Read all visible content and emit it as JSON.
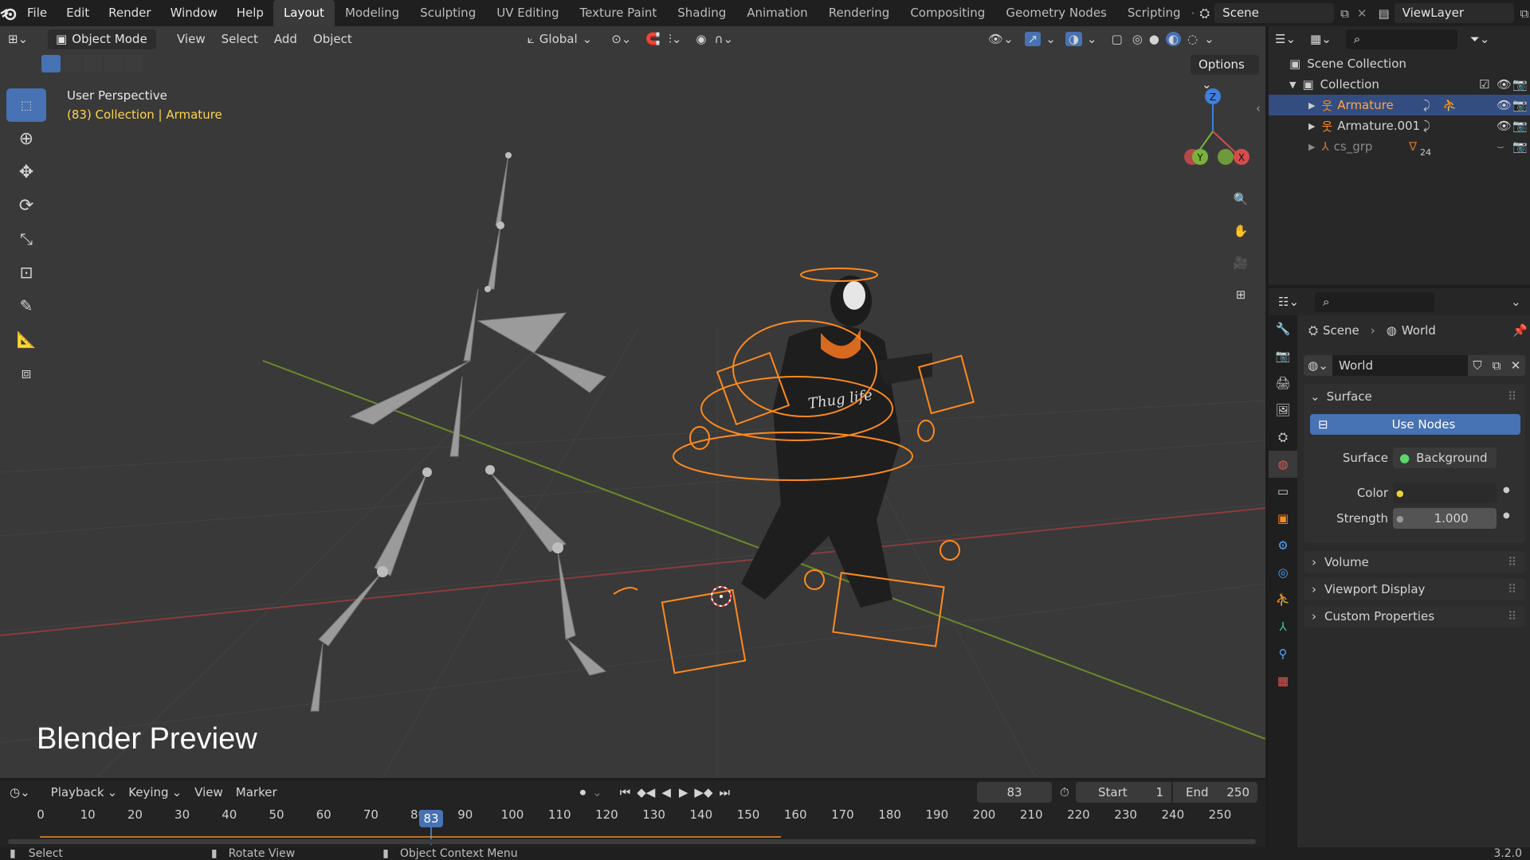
{
  "topbar": {
    "menus": [
      "File",
      "Edit",
      "Render",
      "Window",
      "Help"
    ],
    "workspaces": [
      "Layout",
      "Modeling",
      "Sculpting",
      "UV Editing",
      "Texture Paint",
      "Shading",
      "Animation",
      "Rendering",
      "Compositing",
      "Geometry Nodes",
      "Scripting"
    ],
    "active_workspace": "Layout",
    "scene": "Scene",
    "view_layer": "ViewLayer"
  },
  "viewport_header": {
    "mode": "Object Mode",
    "menus": [
      "View",
      "Select",
      "Add",
      "Object"
    ],
    "transform_orientation": "Global",
    "options_label": "Options"
  },
  "viewport": {
    "perspective_label": "User Perspective",
    "context_prefix": "(83) Collection | ",
    "context_object": "Armature",
    "watermark": "Blender Preview",
    "gizmo_axes": {
      "z": "Z",
      "y": "Y",
      "x": "X"
    }
  },
  "outliner": {
    "title": "Scene Collection",
    "collection": "Collection",
    "items": [
      {
        "label": "Armature",
        "selected": true
      },
      {
        "label": "Armature.001",
        "selected": false
      },
      {
        "label": "cs_grp",
        "selected": false,
        "badge": "24"
      }
    ]
  },
  "properties": {
    "breadcrumb": [
      "Scene",
      "World"
    ],
    "datablock": "World",
    "surface_panel": "Surface",
    "use_nodes": "Use Nodes",
    "surface_label": "Surface",
    "surface_value": "Background",
    "color_label": "Color",
    "strength_label": "Strength",
    "strength_value": "1.000",
    "collapsed_panels": [
      "Volume",
      "Viewport Display",
      "Custom Properties"
    ]
  },
  "timeline": {
    "menus": [
      "Playback",
      "Keying",
      "View",
      "Marker"
    ],
    "current_frame": "83",
    "start_label": "Start",
    "start_value": "1",
    "end_label": "End",
    "end_value": "250",
    "ticks": [
      "0",
      "10",
      "20",
      "30",
      "40",
      "50",
      "60",
      "70",
      "80",
      "90",
      "100",
      "110",
      "120",
      "130",
      "140",
      "150",
      "160",
      "170",
      "180",
      "190",
      "200",
      "210",
      "220",
      "230",
      "240",
      "250"
    ]
  },
  "statusbar": {
    "select": "Select",
    "rotate": "Rotate View",
    "context_menu": "Object Context Menu",
    "version": "3.2.0"
  },
  "colors": {
    "accent": "#4772b3",
    "selection_orange": "#ff8a1e",
    "context_yellow": "#ffd54a"
  }
}
